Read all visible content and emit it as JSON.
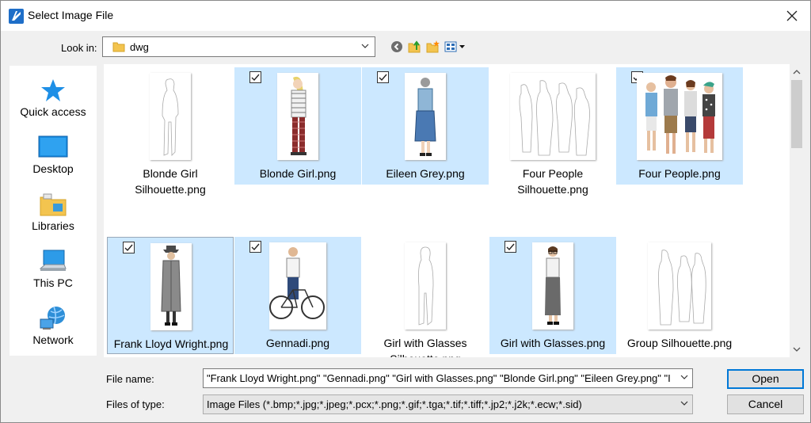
{
  "window": {
    "title": "Select Image File"
  },
  "look_in": {
    "label": "Look in:",
    "value": "dwg"
  },
  "toolbar": {
    "icons": [
      "back-icon",
      "up-folder-icon",
      "new-folder-icon",
      "view-menu-icon"
    ]
  },
  "places": [
    {
      "label": "Quick access",
      "icon": "star-icon"
    },
    {
      "label": "Desktop",
      "icon": "desktop-icon"
    },
    {
      "label": "Libraries",
      "icon": "libraries-icon"
    },
    {
      "label": "This PC",
      "icon": "computer-icon"
    },
    {
      "label": "Network",
      "icon": "network-icon"
    }
  ],
  "files": [
    {
      "label": "Blonde Girl Silhouette.png",
      "selected": false
    },
    {
      "label": "Blonde Girl.png",
      "selected": true
    },
    {
      "label": "Eileen Grey.png",
      "selected": true
    },
    {
      "label": "Four People Silhouette.png",
      "selected": false
    },
    {
      "label": "Four People.png",
      "selected": true
    },
    {
      "label": "Frank Lloyd Wright.png",
      "selected": true
    },
    {
      "label": "Gennadi.png",
      "selected": true
    },
    {
      "label": "Girl with Glasses Silhouette.png",
      "selected": false
    },
    {
      "label": "Girl with Glasses.png",
      "selected": true
    },
    {
      "label": "Group Silhouette.png",
      "selected": false
    }
  ],
  "file_name": {
    "label": "File name:",
    "value": "\"Frank Lloyd Wright.png\" \"Gennadi.png\" \"Girl with Glasses.png\" \"Blonde Girl.png\" \"Eileen Grey.png\" \"I"
  },
  "files_of_type": {
    "label": "Files of type:",
    "value": "Image Files (*.bmp;*.jpg;*.jpeg;*.pcx;*.png;*.gif;*.tga;*.tif;*.tiff;*.jp2;*.j2k;*.ecw;*.sid)"
  },
  "buttons": {
    "open": "Open",
    "cancel": "Cancel"
  },
  "colors": {
    "selection": "#cce8ff",
    "accent": "#0078d7"
  }
}
